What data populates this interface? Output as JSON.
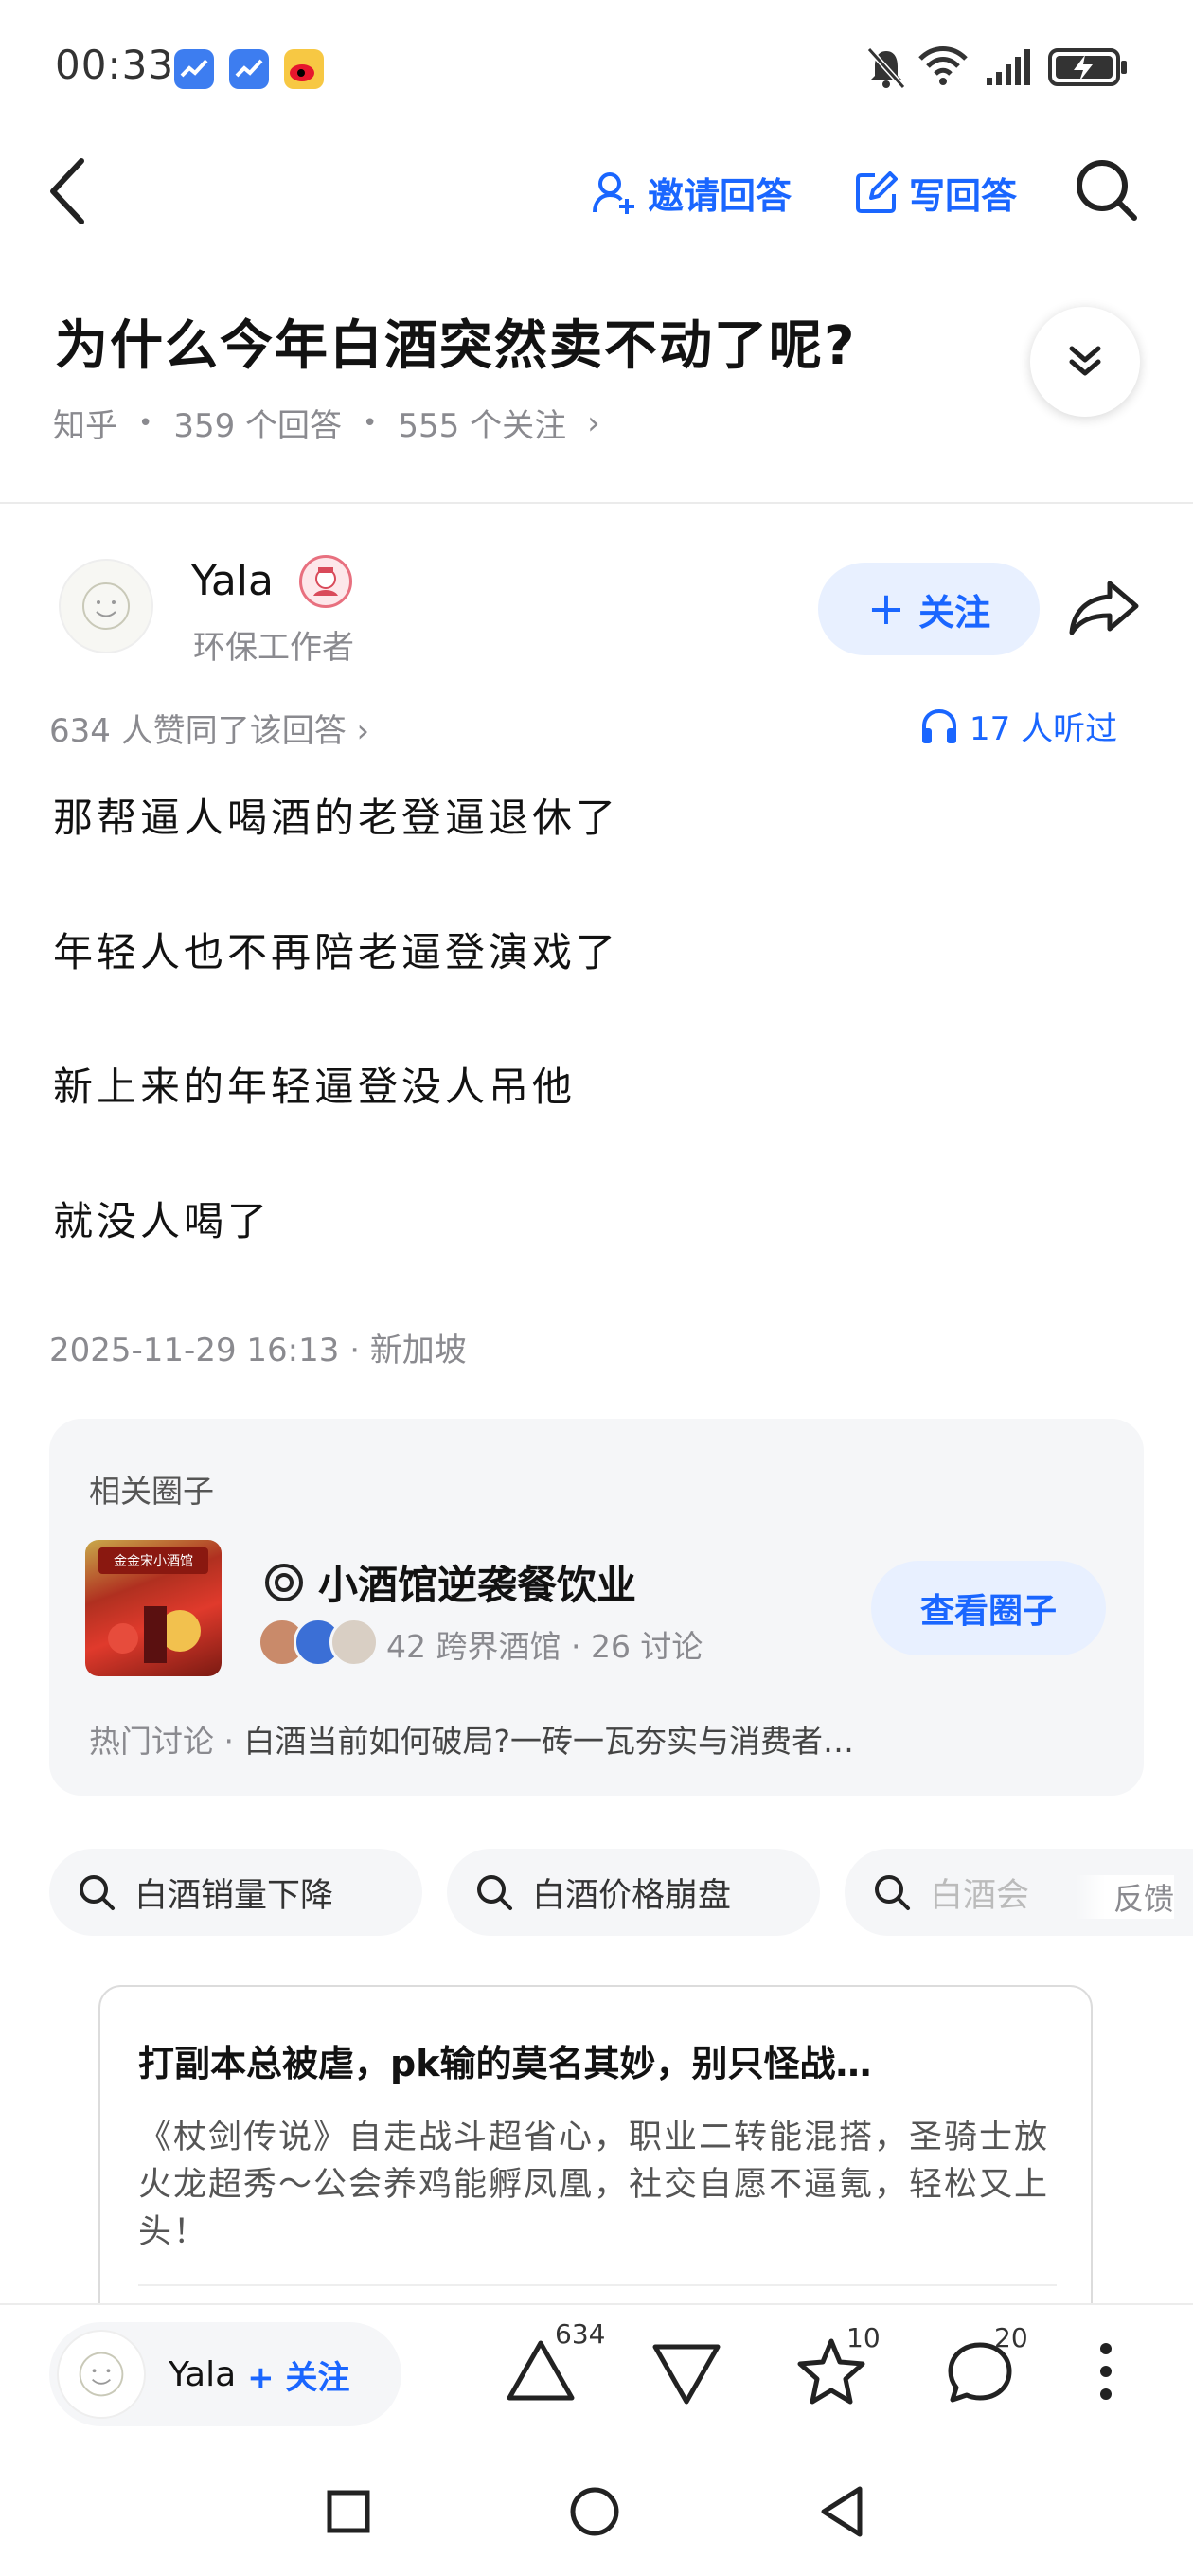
{
  "status_bar": {
    "time": "00:33",
    "app_icons": [
      "finance-app-icon",
      "finance-app-icon",
      "weibo-icon"
    ],
    "indicators": [
      "mute-icon",
      "wifi-icon",
      "signal-icon",
      "battery-charging-icon"
    ]
  },
  "nav": {
    "back_icon": "back-arrow-icon",
    "invite_label": "邀请回答",
    "write_label": "写回答",
    "search_icon": "search-icon"
  },
  "question": {
    "title": "为什么今年白酒突然卖不动了呢?",
    "source": "知乎",
    "answers": "359 个回答",
    "followers": "555 个关注",
    "chevron": "›"
  },
  "author": {
    "name": "Yala",
    "bio": "环保工作者",
    "follow_label": "关注",
    "follow_plus": "+"
  },
  "answer_meta": {
    "upvotes": "634 人赞同了该回答 ›",
    "listened": "17 人听过"
  },
  "answer": {
    "paragraphs": [
      "那帮逼人喝酒的老登逼退休了",
      "年轻人也不再陪老逼登演戏了",
      "新上来的年轻逼登没人吊他",
      "就没人喝了"
    ],
    "timestamp": "2025-11-29 16:13 · 新加坡"
  },
  "circle": {
    "section_label": "相关圈子",
    "name": "小酒馆逆袭餐饮业",
    "thumb_text": "金金宋小酒馆",
    "stats": "42 跨界酒馆  ·  26 讨论",
    "button_label": "查看圈子",
    "hot_label": "热门讨论  ·",
    "hot_text": "白酒当前如何破局?一砖一瓦夯实与消费者…"
  },
  "search_chips": [
    "白酒销量下降",
    "白酒价格崩盘",
    "白酒会"
  ],
  "feedback_label": "反馈",
  "ad": {
    "title": "打副本总被虐，pk输的莫名其妙，别只怪战…",
    "body": "《杖剑传说》自走战斗超省心，职业二转能混搭，圣骑士放火龙超秀～公会养鸡能孵凤凰，社交自愿不逼氪，轻松又上头！"
  },
  "action_bar": {
    "author_name": "Yala",
    "follow_label": "+ 关注",
    "upvote_count": "634",
    "star_count": "10",
    "comment_count": "20"
  },
  "colors": {
    "accent": "#1a66ff",
    "accent_bg": "#e8f0ff",
    "muted_text": "#8a8a8f",
    "card_bg": "#f5f6f8"
  }
}
